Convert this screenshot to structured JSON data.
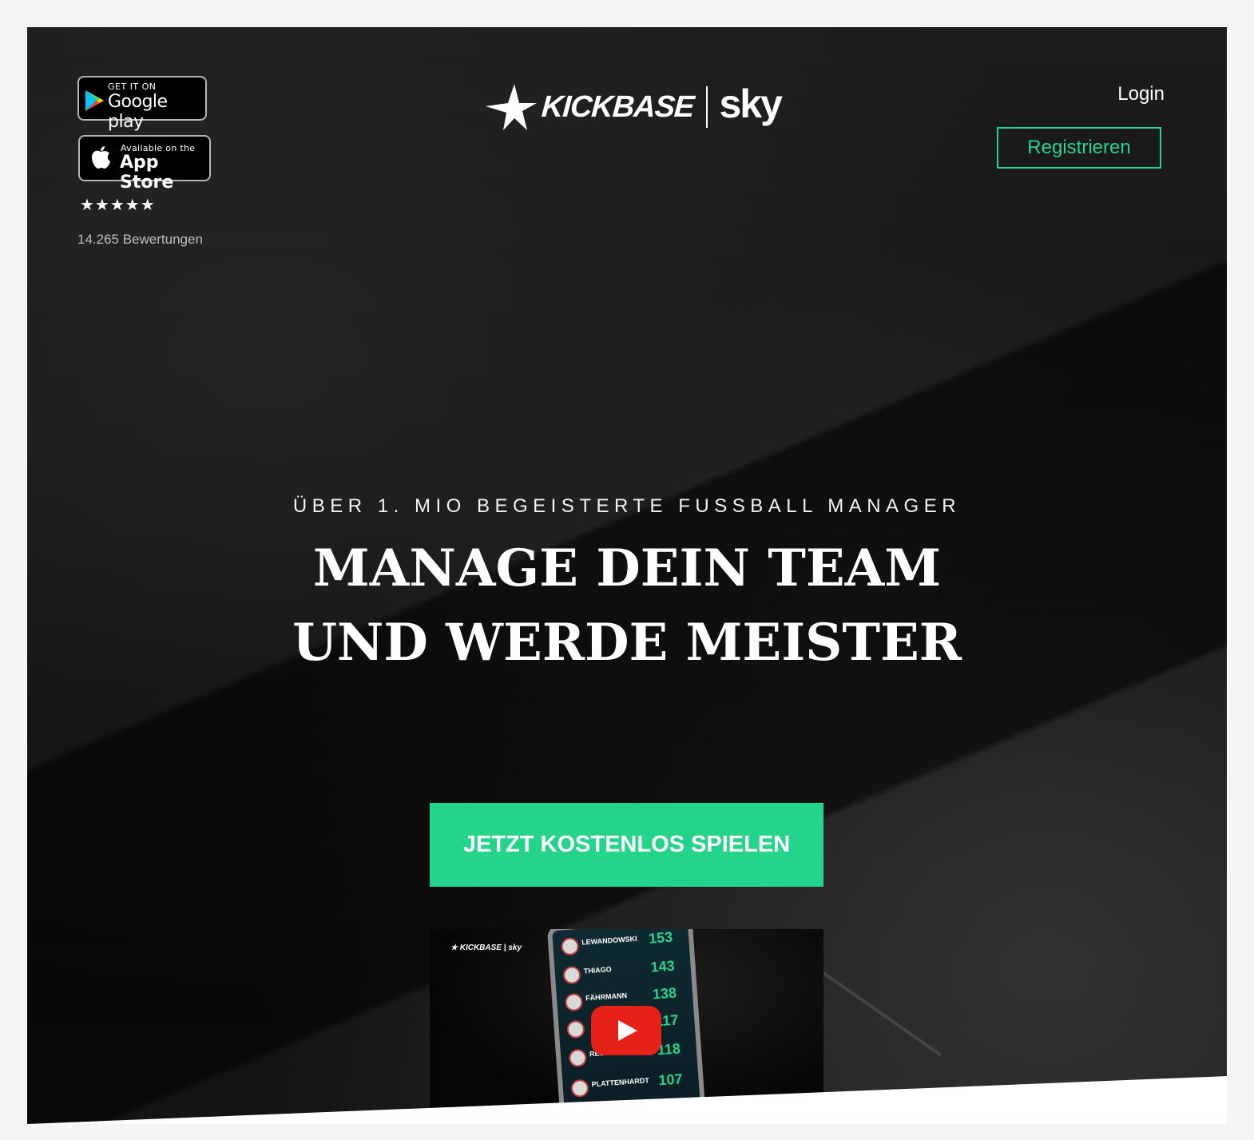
{
  "header": {
    "google_badge": {
      "top": "GET IT ON",
      "main": "Google play"
    },
    "apple_badge": {
      "top": "Available on the",
      "main": "App Store"
    },
    "stars": "★★★★★",
    "reviews": "14.265 Bewertungen",
    "logo": {
      "brand": "KICKBASE",
      "partner": "sky"
    },
    "login_label": "Login",
    "register_label": "Registrieren"
  },
  "hero": {
    "tagline": "ÜBER 1. MIO BEGEISTERTE FUSSBALL MANAGER",
    "headline_line1": "MANAGE DEIN TEAM",
    "headline_line2": "UND WERDE MEISTER",
    "cta_label": "JETZT KOSTENLOS SPIELEN"
  },
  "video": {
    "thumbnail_logo": "★ KICKBASE | sky",
    "players": [
      {
        "name": "LEWANDOWSKI",
        "points": "153"
      },
      {
        "name": "THIAGO",
        "points": "143"
      },
      {
        "name": "FÄHRMANN",
        "points": "138"
      },
      {
        "name": "",
        "points": "117"
      },
      {
        "name": "REUS",
        "points": "118"
      },
      {
        "name": "PLATTENHARDT",
        "points": "107"
      }
    ]
  },
  "colors": {
    "accent_green": "#23d48a",
    "register_green": "#2ad38a",
    "youtube_red": "#e62117",
    "background_dark": "#141414"
  }
}
